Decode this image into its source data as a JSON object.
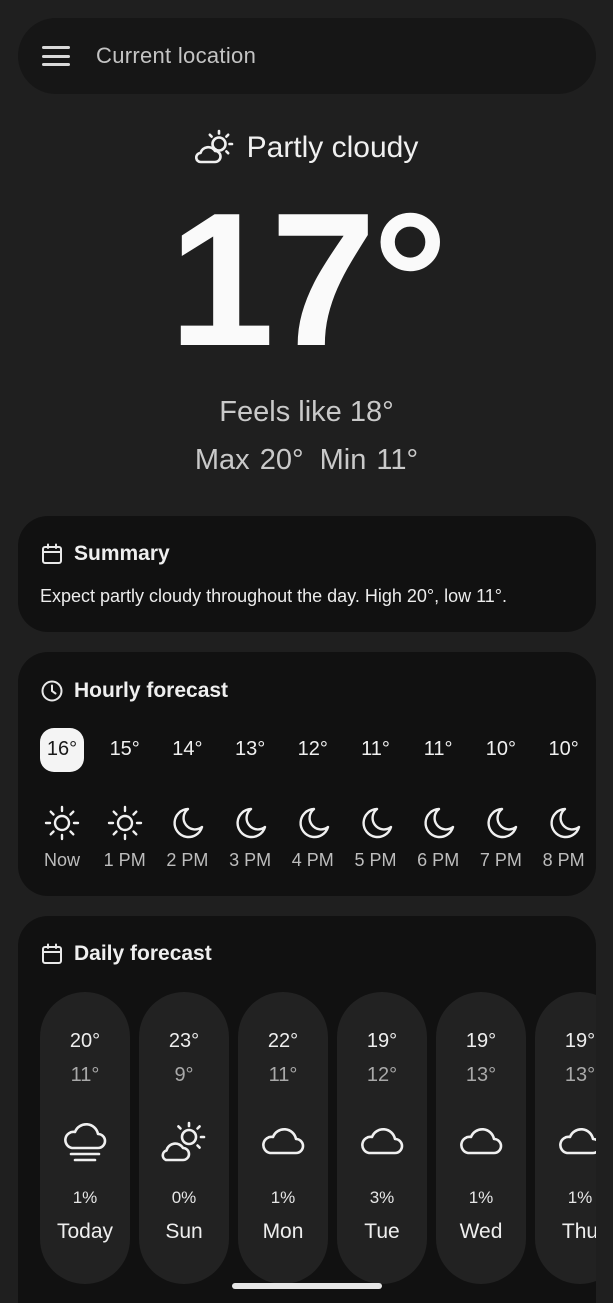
{
  "search": {
    "label": "Current location",
    "menu_icon": "menu-icon"
  },
  "current": {
    "condition": "Partly cloudy",
    "condition_icon": "partly-cloudy-icon",
    "temperature": "17°",
    "feels_like": "Feels like 18°",
    "max": "Max 20°",
    "min": "Min 11°"
  },
  "summary": {
    "title": "Summary",
    "text": "Expect partly cloudy throughout the day. High 20°, low 11°."
  },
  "hourly": {
    "title": "Hourly forecast",
    "items": [
      {
        "temp": "16°",
        "icon": "sun-icon",
        "label": "Now"
      },
      {
        "temp": "15°",
        "icon": "sun-icon",
        "label": "1 PM"
      },
      {
        "temp": "14°",
        "icon": "moon-icon",
        "label": "2 PM"
      },
      {
        "temp": "13°",
        "icon": "moon-icon",
        "label": "3 PM"
      },
      {
        "temp": "12°",
        "icon": "moon-icon",
        "label": "4 PM"
      },
      {
        "temp": "11°",
        "icon": "moon-icon",
        "label": "5 PM"
      },
      {
        "temp": "11°",
        "icon": "moon-icon",
        "label": "6 PM"
      },
      {
        "temp": "10°",
        "icon": "moon-icon",
        "label": "7 PM"
      },
      {
        "temp": "10°",
        "icon": "moon-icon",
        "label": "8 PM"
      }
    ]
  },
  "daily": {
    "title": "Daily forecast",
    "items": [
      {
        "high": "20°",
        "low": "11°",
        "icon": "fog-cloud-icon",
        "rain": "1%",
        "day": "Today"
      },
      {
        "high": "23°",
        "low": "9°",
        "icon": "partly-cloudy-icon",
        "rain": "0%",
        "day": "Sun"
      },
      {
        "high": "22°",
        "low": "11°",
        "icon": "cloud-icon",
        "rain": "1%",
        "day": "Mon"
      },
      {
        "high": "19°",
        "low": "12°",
        "icon": "cloud-icon",
        "rain": "3%",
        "day": "Tue"
      },
      {
        "high": "19°",
        "low": "13°",
        "icon": "cloud-icon",
        "rain": "1%",
        "day": "Wed"
      },
      {
        "high": "19°",
        "low": "13°",
        "icon": "cloud-icon",
        "rain": "1%",
        "day": "Thu"
      }
    ]
  },
  "colors": {
    "background": "#1f1f1f",
    "card": "#111111",
    "pill": "#222222",
    "text": "#f2f2f2"
  }
}
